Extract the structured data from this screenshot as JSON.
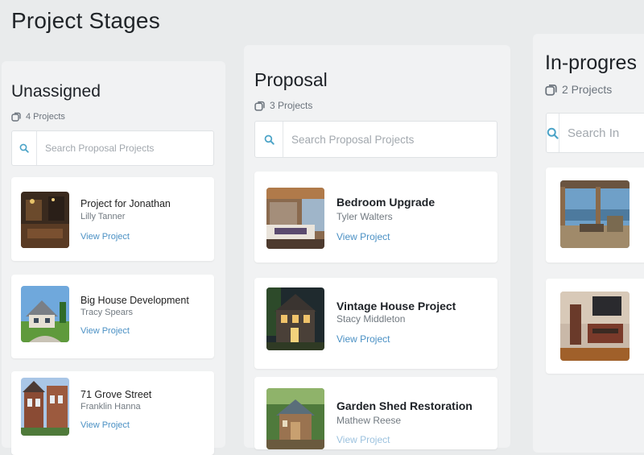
{
  "page": {
    "title": "Project Stages"
  },
  "columns": [
    {
      "title": "Unassigned",
      "count": "4 Projects",
      "search_placeholder": "Search Proposal Projects",
      "cards": [
        {
          "title": "Project for Jonathan",
          "owner": "Lilly Tanner",
          "link": "View Project"
        },
        {
          "title": "Big House Development",
          "owner": "Tracy Spears",
          "link": "View Project"
        },
        {
          "title": "71 Grove Street",
          "owner": "Franklin Hanna",
          "link": "View Project"
        }
      ]
    },
    {
      "title": "Proposal",
      "count": "3 Projects",
      "search_placeholder": "Search Proposal Projects",
      "cards": [
        {
          "title": "Bedroom Upgrade",
          "owner": "Tyler Walters",
          "link": "View Project"
        },
        {
          "title": "Vintage House Project",
          "owner": "Stacy Middleton",
          "link": "View Project"
        },
        {
          "title": "Garden Shed Restoration",
          "owner": "Mathew Reese",
          "link": "View Project"
        }
      ]
    },
    {
      "title": "In-progres",
      "count": "2 Projects",
      "search_placeholder": "Search In",
      "cards": [
        {},
        {}
      ]
    }
  ],
  "colors": {
    "accent": "#4a90c4",
    "background": "#e9ebec",
    "column": "#f1f2f3",
    "card": "#ffffff"
  },
  "icons": {
    "count": "folder-stack-icon",
    "search": "search-icon"
  }
}
